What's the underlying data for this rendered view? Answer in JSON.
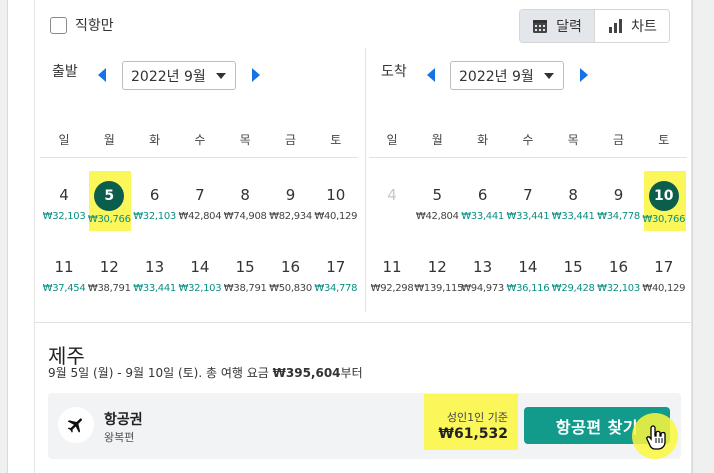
{
  "filters": {
    "direct_only": "직항만"
  },
  "view_toggle": {
    "calendar": "달력",
    "chart": "차트",
    "active": "calendar"
  },
  "departure": {
    "label": "출발",
    "month": "2022년 9월",
    "weekdays": [
      "일",
      "월",
      "화",
      "수",
      "목",
      "금",
      "토"
    ],
    "weeks": [
      [
        {
          "day": "4",
          "price": "₩32,103",
          "color": "green"
        },
        {
          "day": "5",
          "price": "₩30,766",
          "color": "green",
          "selected": true
        },
        {
          "day": "6",
          "price": "₩32,103",
          "color": "green"
        },
        {
          "day": "7",
          "price": "₩42,804",
          "color": "dark"
        },
        {
          "day": "8",
          "price": "₩74,908",
          "color": "dark"
        },
        {
          "day": "9",
          "price": "₩82,934",
          "color": "dark"
        },
        {
          "day": "10",
          "price": "₩40,129",
          "color": "dark"
        }
      ],
      [
        {
          "day": "11",
          "price": "₩37,454",
          "color": "green"
        },
        {
          "day": "12",
          "price": "₩38,791",
          "color": "dark"
        },
        {
          "day": "13",
          "price": "₩33,441",
          "color": "green"
        },
        {
          "day": "14",
          "price": "₩32,103",
          "color": "green"
        },
        {
          "day": "15",
          "price": "₩38,791",
          "color": "dark"
        },
        {
          "day": "16",
          "price": "₩50,830",
          "color": "dark"
        },
        {
          "day": "17",
          "price": "₩34,778",
          "color": "green"
        }
      ]
    ]
  },
  "arrival": {
    "label": "도착",
    "month": "2022년 9월",
    "weekdays": [
      "일",
      "월",
      "화",
      "수",
      "목",
      "금",
      "토"
    ],
    "weeks": [
      [
        {
          "day": "4",
          "price": "",
          "color": "muted"
        },
        {
          "day": "5",
          "price": "₩42,804",
          "color": "dark"
        },
        {
          "day": "6",
          "price": "₩33,441",
          "color": "green"
        },
        {
          "day": "7",
          "price": "₩33,441",
          "color": "green"
        },
        {
          "day": "8",
          "price": "₩33,441",
          "color": "green"
        },
        {
          "day": "9",
          "price": "₩34,778",
          "color": "green"
        },
        {
          "day": "10",
          "price": "₩30,766",
          "color": "green",
          "selected": true
        }
      ],
      [
        {
          "day": "11",
          "price": "₩92,298",
          "color": "dark"
        },
        {
          "day": "12",
          "price": "₩139,115",
          "color": "dark"
        },
        {
          "day": "13",
          "price": "₩94,973",
          "color": "dark"
        },
        {
          "day": "14",
          "price": "₩36,116",
          "color": "green"
        },
        {
          "day": "15",
          "price": "₩29,428",
          "color": "green"
        },
        {
          "day": "16",
          "price": "₩32,103",
          "color": "green"
        },
        {
          "day": "17",
          "price": "₩40,129",
          "color": "dark"
        }
      ]
    ]
  },
  "trip": {
    "destination": "제주",
    "summary_prefix": "9월 5일 (월) - 9월 10일 (토). 총 여행 요금 ",
    "summary_total": "₩395,604",
    "summary_suffix": "부터"
  },
  "fare": {
    "title": "항공권",
    "subtitle": "왕복편",
    "price_note": "성인1인 기준",
    "price": "₩61,532",
    "button": "항공편 찾기"
  },
  "colors": {
    "accent": "#129a8b",
    "selected": "#0b5e4b",
    "highlight": "#fbf75b",
    "nav_arrow": "#1573e6",
    "cheap_price": "#0b8f82"
  }
}
